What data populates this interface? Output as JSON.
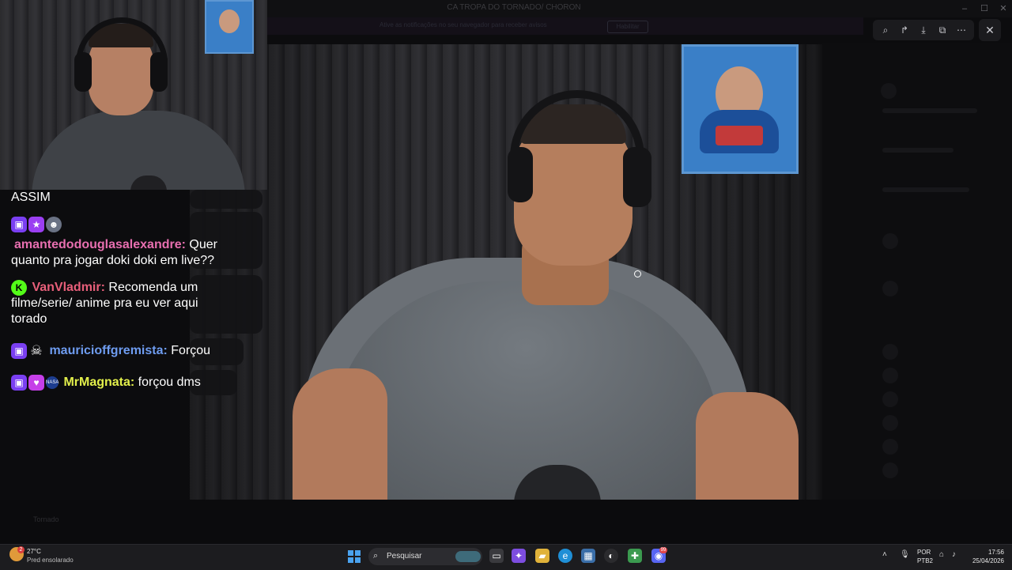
{
  "window": {
    "title": "CA TROPA DO TORNADO/ CHORON",
    "banner_text": "Ative as notificações no seu navegador para receber avisos",
    "banner_button": "Habilitar"
  },
  "viewer_toolbar": {
    "zoom_icon": "zoom-in-icon",
    "forward_icon": "forward-icon",
    "download_icon": "download-icon",
    "open_icon": "open-external-icon",
    "more_icon": "more-icon",
    "close_icon": "close-icon"
  },
  "chat": {
    "messages": [
      {
        "user": "",
        "text": "ASSIM",
        "name_color": "#ffffff",
        "badges": []
      },
      {
        "user": "amantedodouglasalexandre:",
        "text": " Quer quanto pra jogar doki doki em live??",
        "name_color": "#e86fb0",
        "badges": [
          "twitch-badge",
          "star-badge",
          "sticker-badge"
        ]
      },
      {
        "user": "VanVladmir:",
        "text": " Recomenda um filme/serie/ anime pra eu ver aqui torado",
        "name_color": "#e85f7a",
        "badges": [
          "kick-badge"
        ]
      },
      {
        "user": "mauricioffgremista:",
        "text": " Forçou",
        "name_color": "#6e9cf0",
        "badges": [
          "twitch-badge",
          "skull-badge"
        ]
      },
      {
        "user": "MrMagnata:",
        "text": " forçou dms",
        "name_color": "#e3f04b",
        "badges": [
          "twitch-badge",
          "heart-badge",
          "nasa-badge"
        ]
      }
    ],
    "badge_glyphs": {
      "twitch": "▣",
      "star": "★",
      "kick": "K",
      "skull": "☠",
      "heart": "♥",
      "nasa": "NASA",
      "sticker": "☻"
    }
  },
  "background_app": {
    "bottom_label": "Tornado"
  },
  "taskbar": {
    "weather_temp": "27°C",
    "weather_desc": "Pred ensolarado",
    "weather_badge": "2",
    "search_placeholder": "Pesquisar",
    "lang_line1": "POR",
    "lang_line2": "PTB2",
    "time": "17:56",
    "date": "25/04/2026",
    "discord_badge": "99",
    "colors": {
      "start": "#4aa3f0",
      "background": "#1c1c1f"
    }
  }
}
